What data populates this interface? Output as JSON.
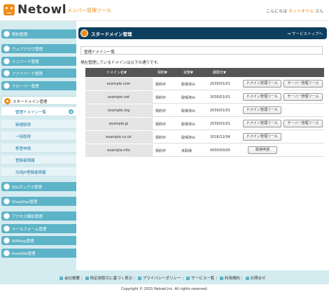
{
  "header": {
    "brand": "Netowl",
    "subtitle": "メンバー管理ツール",
    "welcome_prefix": "こんにちは",
    "user": "ネットオウル",
    "welcome_suffix": "さん"
  },
  "sidebar": {
    "groups": [
      {
        "label": "契約管理"
      },
      {
        "label": "ウェブクロウ管理"
      },
      {
        "label": "ミニバード管理"
      },
      {
        "label": "ファイバード管理"
      },
      {
        "label": "クローバー管理"
      },
      {
        "label": "スタードメイン管理"
      },
      {
        "label": "SSLボックス管理"
      },
      {
        "label": "ShopStar管理"
      },
      {
        "label": "アクセス解析管理"
      },
      {
        "label": "メールフォーム管理"
      },
      {
        "label": "WPblog管理"
      },
      {
        "label": "freeWiki管理"
      }
    ],
    "sub_items": [
      {
        "label": "管理ドメイン一覧"
      },
      {
        "label": "新規取得"
      },
      {
        "label": "一括取得"
      },
      {
        "label": "移管申請"
      },
      {
        "label": "登録者情報"
      },
      {
        "label": "汎用JP登録者情報"
      }
    ]
  },
  "page": {
    "title": "スタードメイン管理",
    "service_link": "サービストップへ",
    "section_title": "管理ドメイン一覧",
    "description": "現在管理しているドメインは以下の通りです。"
  },
  "table": {
    "headers": [
      "ドメイン名▼",
      "契約▼",
      "状態▼",
      "期限日▼"
    ],
    "rows": [
      {
        "domain": "example.com",
        "contract": "契約中",
        "status": "取得済み",
        "expiry": "2030/01/01",
        "buttons": [
          "ドメイン管理ツール",
          "サーバー管理ツール"
        ]
      },
      {
        "domain": "example.net",
        "contract": "契約中",
        "status": "取得済み",
        "expiry": "2030/01/01",
        "buttons": [
          "ドメイン管理ツール",
          "サーバー管理ツール"
        ]
      },
      {
        "domain": "example.org",
        "contract": "契約中",
        "status": "取得済み",
        "expiry": "2030/01/01",
        "buttons": [
          "ドメイン管理ツール"
        ]
      },
      {
        "domain": "example.jp",
        "contract": "契約中",
        "status": "取得済み",
        "expiry": "2030/01/01",
        "buttons": [
          "ドメイン管理ツール",
          "サーバー管理ツール"
        ]
      },
      {
        "domain": "example.co.uk",
        "contract": "契約中",
        "status": "取得済み",
        "expiry": "2016/12/04",
        "buttons": [
          "ドメイン管理ツール"
        ]
      },
      {
        "domain": "example.info",
        "contract": "契約中",
        "status": "未取得",
        "expiry": "0000/00/00",
        "buttons": [
          "取得申請"
        ]
      }
    ]
  },
  "footer": {
    "links": [
      "会社概要",
      "特定商取引に基づく表示",
      "プライバシーポリシー",
      "サービス一覧",
      "利用規約",
      "お問合せ"
    ],
    "copyright": "Copyright © 2015 Netowl,Inc. All rights reserved."
  },
  "colors": {
    "accent": "#f08c1a",
    "sidebar_bg": "#d4ebf0",
    "nav_group": "#5db3c7",
    "title_bar": "#0d3f5f",
    "link": "#1673a7"
  }
}
